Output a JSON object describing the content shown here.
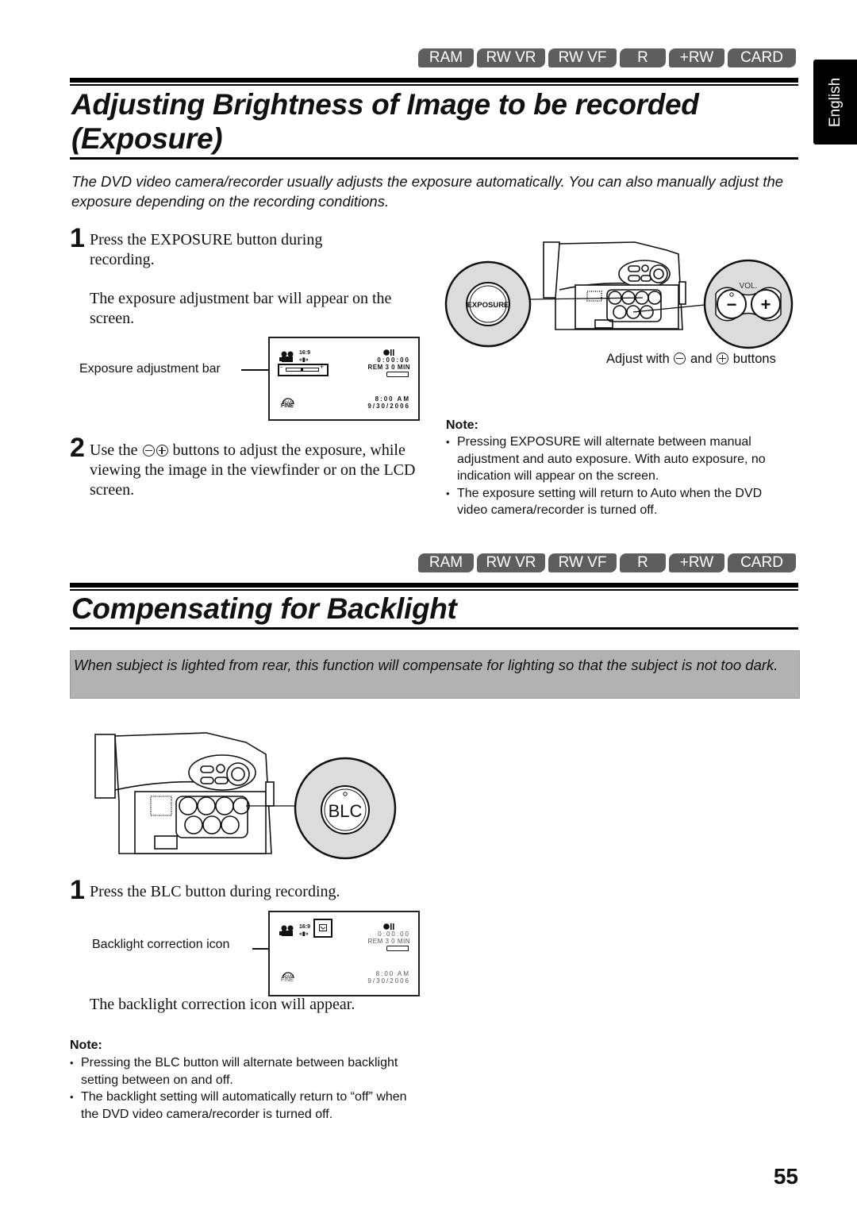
{
  "media_badges": [
    "RAM",
    "RW VR",
    "RW VF",
    "R",
    "+RW",
    "CARD"
  ],
  "language_tab": "English",
  "section1": {
    "title_line1": "Adjusting Brightness of Image to be recorded",
    "title_line2": "(Exposure)",
    "intro": "The DVD video camera/recorder usually adjusts the exposure automatically. You can also manually adjust the exposure depending on the recording conditions.",
    "step1": {
      "number": "1",
      "text": "Press the EXPOSURE button during recording.",
      "detail": "The exposure adjustment bar will appear on the screen."
    },
    "step2": {
      "number": "2",
      "text_before": "Use the",
      "text_after": "buttons to adjust the exposure, while viewing the image in the viewfinder or on the LCD screen."
    },
    "osd": {
      "callout": "Exposure adjustment bar",
      "aspect": "16:9",
      "timecode": "0:00:00",
      "remaining": "REM 3 0 MIN",
      "time": "8:00 AM",
      "date": "9/30/2006",
      "quality": "FINE",
      "media": "RAM",
      "bar_minus": "-",
      "bar_plus": "+",
      "exposure_level": 0.5
    },
    "illustration": {
      "button_label": "EXPOSURE",
      "vol_label": "VOL.",
      "minus": "−",
      "plus": "+",
      "caption_before": "Adjust with",
      "caption_mid": "and",
      "caption_after": "buttons"
    },
    "note": {
      "title": "Note:",
      "items": [
        "Pressing EXPOSURE will alternate between manual adjustment and auto exposure. With auto exposure, no indication will appear on the screen.",
        "The exposure setting will return to Auto when the DVD video camera/recorder is turned off."
      ]
    }
  },
  "section2": {
    "title": "Compensating for Backlight",
    "intro": "When subject is lighted from rear, this function will compensate for lighting so that the subject is not too dark.",
    "illustration": {
      "button_label": "BLC"
    },
    "step1": {
      "number": "1",
      "text": "Press the BLC button during recording.",
      "result": "The backlight correction icon will appear."
    },
    "osd": {
      "callout": "Backlight correction icon",
      "aspect": "16:9",
      "timecode": "0:00:00",
      "remaining": "REM 3 0 MIN",
      "time": "8:00 AM",
      "date": "9/30/2006",
      "quality": "FINE",
      "media": "RAM"
    },
    "note": {
      "title": "Note:",
      "items": [
        "Pressing the BLC button will alternate between backlight setting between on and off.",
        "The backlight setting will automatically return to “off” when the DVD video camera/recorder is turned off."
      ]
    }
  },
  "page_number": "55"
}
